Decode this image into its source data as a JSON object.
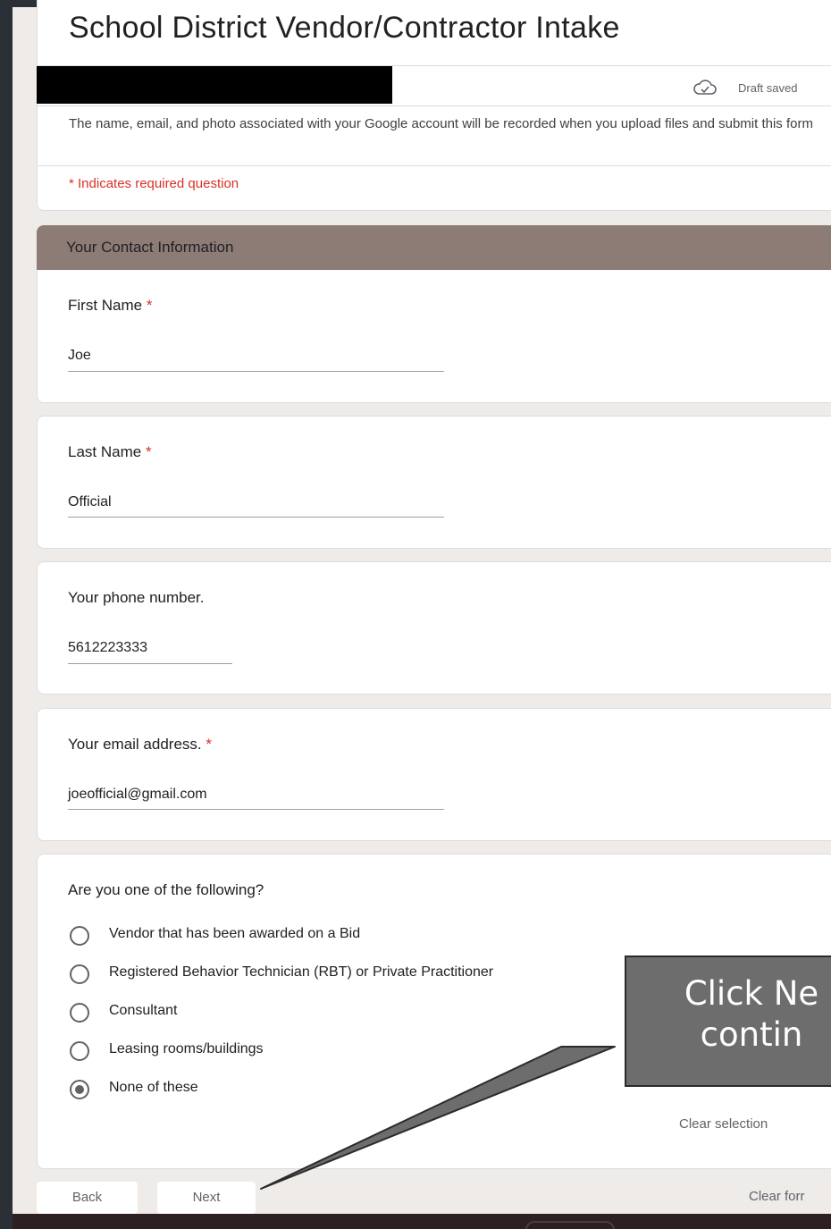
{
  "form": {
    "title": "School District Vendor/Contractor Intake",
    "draft_status": "Draft saved",
    "account_notice": "The name, email, and photo associated with your Google account will be recorded when you upload files and submit this form",
    "required_note": "* Indicates required question"
  },
  "section": {
    "title": "Your Contact Information"
  },
  "questions": {
    "first_name": {
      "label": "First Name",
      "required_mark": "*",
      "value": "Joe"
    },
    "last_name": {
      "label": "Last Name",
      "required_mark": "*",
      "value": "Official"
    },
    "phone": {
      "label": "Your phone number.",
      "value": "5612223333"
    },
    "email": {
      "label": "Your email address.",
      "required_mark": "*",
      "value": "joeofficial@gmail.com"
    },
    "role": {
      "label": "Are you one of the following?",
      "options": [
        "Vendor that has been awarded on a Bid",
        "Registered Behavior Technician (RBT) or Private Practitioner",
        "Consultant",
        "Leasing rooms/buildings",
        "None of these"
      ],
      "selected": "None of these",
      "clear_label": "Clear selection"
    }
  },
  "nav": {
    "back_label": "Back",
    "next_label": "Next",
    "clear_form_label": "Clear forr"
  },
  "callout": {
    "text": "Click Ne\ncontin"
  },
  "icons": {
    "draft": "cloud-check-icon"
  },
  "colors": {
    "page_bg": "#efebe9",
    "section_header": "#8d7b76",
    "required": "#d93025",
    "callout_bg": "#6d6d6d",
    "backdrop": "#2b2f36"
  }
}
